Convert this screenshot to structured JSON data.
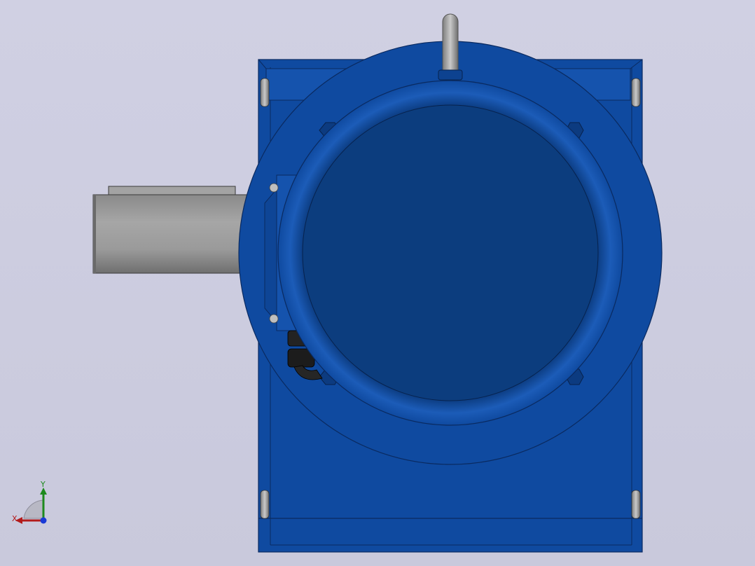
{
  "viewport": {
    "background_color": "#cfcfe2",
    "model": {
      "name": "worm-gear-reducer",
      "housing_color": "#0f4aa0",
      "shaft_color": "#9a9a9a",
      "eyebolt_color": "#a8a8a8",
      "gland_color": "#1e1e1e"
    }
  },
  "triad": {
    "x_label": "X",
    "y_label": "Y",
    "x_color": "#b31b1b",
    "y_color": "#1d8a1d",
    "z_color": "#1a3ad6"
  }
}
